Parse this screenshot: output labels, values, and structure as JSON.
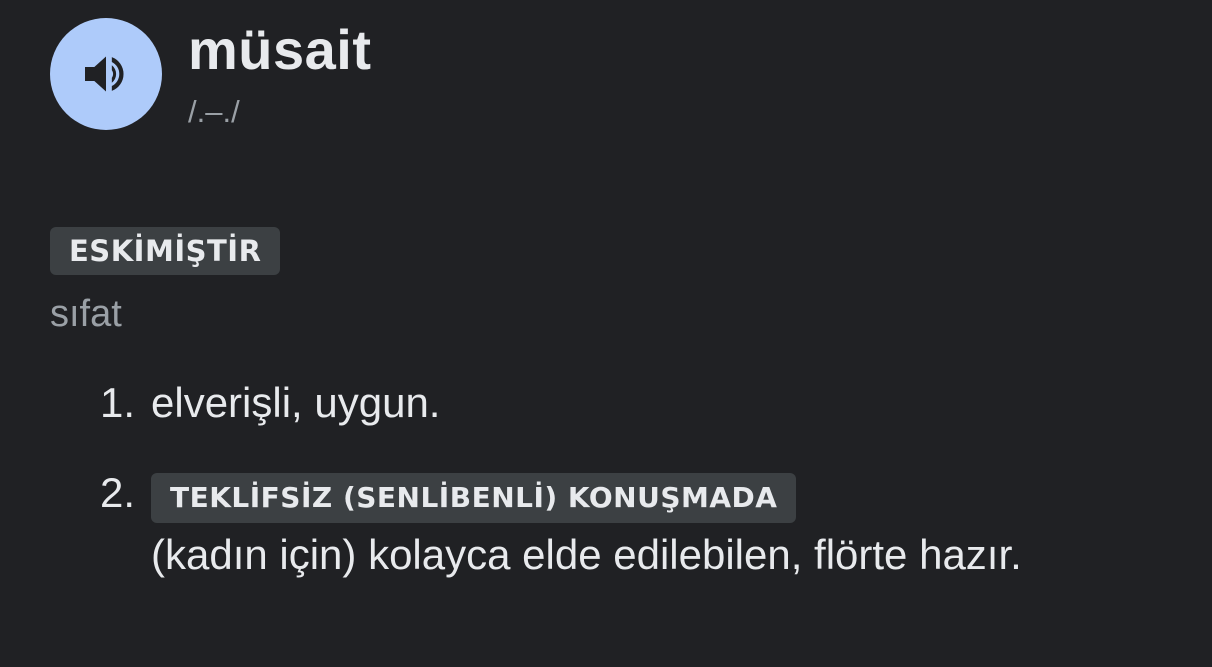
{
  "entry": {
    "headword": "müsait",
    "phonetic": "/.–./",
    "register_label": "ESKİMİŞTİR",
    "part_of_speech": "sıfat",
    "audio_icon": "speaker-icon",
    "colors": {
      "background": "#202124",
      "audio_button_bg": "#aecbfa",
      "audio_icon": "#202124",
      "chip_bg": "#3c4043",
      "muted_text": "#9aa0a6",
      "text": "#e8eaed"
    }
  },
  "senses": [
    {
      "number": "1.",
      "label": "",
      "definition": "elverişli, uygun."
    },
    {
      "number": "2.",
      "label": "TEKLİFSİZ (SENLİBENLİ) KONUŞMADA",
      "definition": "(kadın için) kolayca elde edilebilen, flörte hazır."
    }
  ]
}
